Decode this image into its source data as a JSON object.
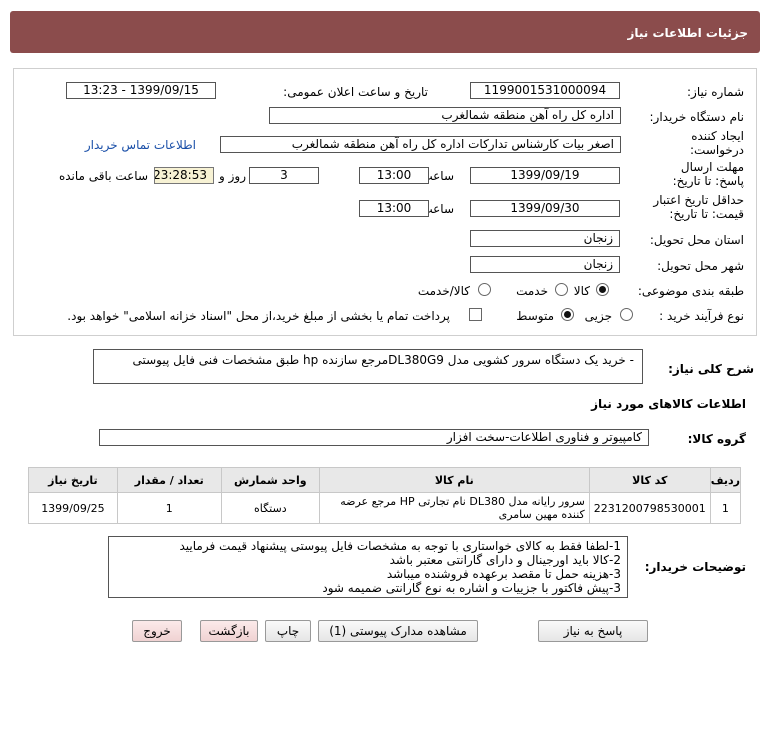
{
  "header": {
    "title": "جزئیات اطلاعات نیاز"
  },
  "fields": {
    "need_number_label": "شماره نیاز:",
    "need_number": "1199001531000094",
    "announce_label": "تاریخ و ساعت اعلان عمومی:",
    "announce_value": "1399/09/15 - 13:23",
    "buyer_label": "نام دستگاه خریدار:",
    "buyer_value": "اداره کل راه آهن منطقه شمالغرب",
    "creator_label": "ایجاد کننده درخواست:",
    "creator_value": "اصغر بیات کارشناس تدارکات اداره کل راه آهن منطقه شمالغرب",
    "contact_link": "اطلاعات تماس خریدار",
    "deadline_label": "مهلت ارسال پاسخ: تا تاریخ:",
    "deadline_date": "1399/09/19",
    "time_label": "ساعت",
    "deadline_time": "13:00",
    "days_value": "3",
    "days_label": "روز و",
    "timer_value": "23:28:53",
    "remaining_label": "ساعت باقی مانده",
    "validity_label": "حداقل تاریخ اعتبار قیمت: تا تاریخ:",
    "validity_date": "1399/09/30",
    "validity_time": "13:00",
    "province_label": "استان محل تحویل:",
    "province_value": "زنجان",
    "city_label": "شهر محل تحویل:",
    "city_value": "زنجان",
    "category_label": "طبقه بندی موضوعی:",
    "category_options": [
      "کالا",
      "خدمت",
      "کالا/خدمت"
    ],
    "purchase_label": "نوع فرآیند خرید :",
    "purchase_options": [
      "جزیی",
      "متوسط"
    ],
    "payment_note": "پرداخت تمام یا بخشی از مبلغ خرید،از محل \"اسناد خزانه اسلامی\" خواهد بود."
  },
  "description": {
    "label": "شرح کلی نیاز:",
    "value": "- خرید یک دستگاه سرور کشویی مدل DL380G9مرجع سازنده hp طبق مشخصات فنی فایل پیوستی"
  },
  "goods": {
    "section_title": "اطلاعات کالاهای مورد نیاز",
    "group_label": "گروه کالا:",
    "group_value": "کامپیوتر و فناوری اطلاعات-سخت افزار",
    "columns": [
      "ردیف",
      "کد کالا",
      "نام کالا",
      "واحد شمارش",
      "تعداد / مقدار",
      "تاریخ نیاز"
    ],
    "rows": [
      {
        "row": "1",
        "code": "2231200798530001",
        "name": "سرور رایانه مدل DL380 نام تجارتی HP مرجع عرضه کننده مهین سامری",
        "unit": "دستگاه",
        "qty": "1",
        "date": "1399/09/25"
      }
    ]
  },
  "notes": {
    "label": "توضیحات خریدار:",
    "lines": [
      "1-لطفا فقط به کالای خواستاری با توجه به مشخصات فایل پیوستی پیشنهاد قیمت فرمایید",
      "2-کالا باید اورجینال و دارای گارانتی معتبر باشد",
      "3-هزینه حمل تا مقصد برعهده فروشنده میباشد",
      "3-پیش فاکتور با جزییات و اشاره به نوع گارانتی ضمیمه شود"
    ]
  },
  "buttons": {
    "reply": "پاسخ به نیاز",
    "attachments": "مشاهده مدارک پیوستی (1)",
    "print": "چاپ",
    "back": "بازگشت",
    "exit": "خروج"
  }
}
